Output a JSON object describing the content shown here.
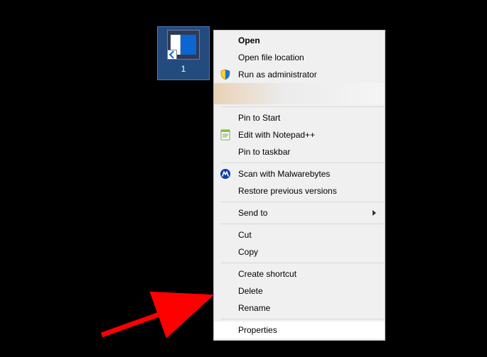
{
  "desktop_icon": {
    "label": "1"
  },
  "context_menu": {
    "groups": [
      [
        {
          "id": "open",
          "label": "Open",
          "bold": true
        },
        {
          "id": "open-file-location",
          "label": "Open file location"
        },
        {
          "id": "run-as-admin",
          "label": "Run as administrator",
          "icon": "shield-icon"
        },
        {
          "id": "obscured-item",
          "label": "",
          "obscured": true
        }
      ],
      [
        {
          "id": "pin-to-start",
          "label": "Pin to Start"
        },
        {
          "id": "edit-notepadpp",
          "label": "Edit with Notepad++",
          "icon": "notepad-icon"
        },
        {
          "id": "pin-to-taskbar",
          "label": "Pin to taskbar"
        }
      ],
      [
        {
          "id": "scan-malwarebytes",
          "label": "Scan with Malwarebytes",
          "icon": "malwarebytes-icon"
        },
        {
          "id": "restore-versions",
          "label": "Restore previous versions"
        }
      ],
      [
        {
          "id": "send-to",
          "label": "Send to",
          "submenu": true
        }
      ],
      [
        {
          "id": "cut",
          "label": "Cut"
        },
        {
          "id": "copy",
          "label": "Copy"
        }
      ],
      [
        {
          "id": "create-shortcut",
          "label": "Create shortcut"
        },
        {
          "id": "delete",
          "label": "Delete"
        },
        {
          "id": "rename",
          "label": "Rename"
        }
      ],
      [
        {
          "id": "properties",
          "label": "Properties",
          "hovered": true
        }
      ]
    ]
  },
  "annotation": {
    "arrow_color": "#ff0000"
  }
}
